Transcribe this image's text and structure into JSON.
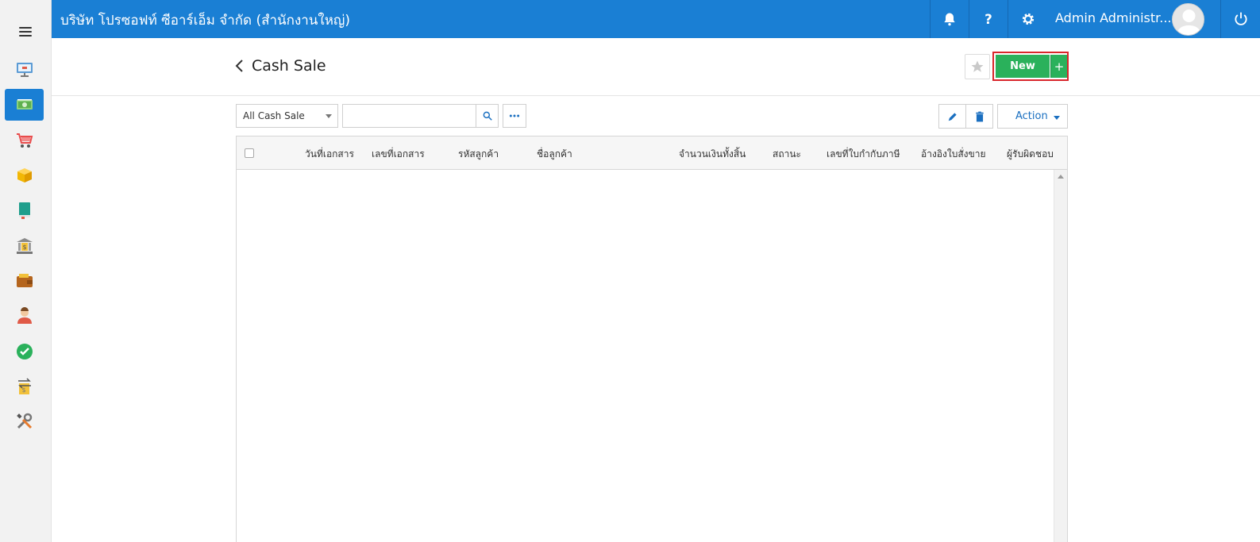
{
  "topbar": {
    "company": "บริษัท โปรซอฟท์ ซีอาร์เอ็ม จำกัด (สำนักงานใหญ่)",
    "user_name": "Admin Administr...",
    "bg_color": "#1a7fd4",
    "icons": [
      "bell-icon",
      "help-icon",
      "gear-icon",
      "power-icon"
    ]
  },
  "sidebar": {
    "items": [
      "dashboard-icon",
      "cash-icon",
      "cart-icon",
      "box-icon",
      "book-icon",
      "bank-icon",
      "wallet-icon",
      "user-icon",
      "check-icon",
      "transfer-icon",
      "tools-icon"
    ],
    "active_index": 1
  },
  "page": {
    "title": "Cash Sale",
    "new_label": "New",
    "plus_label": "+"
  },
  "toolbar": {
    "filter_value": "All Cash Sale",
    "search_value": "",
    "action_label": "Action"
  },
  "table": {
    "columns": [
      "วันที่เอกสาร",
      "เลขที่เอกสาร",
      "รหัสลูกค้า",
      "ชื่อลูกค้า",
      "จำนวนเงินทั้งสิ้น",
      "สถานะ",
      "เลขที่ใบกำกับภาษี",
      "อ้างอิงใบสั่งขาย",
      "ผู้รับผิดชอบ"
    ],
    "rows": []
  },
  "colors": {
    "accent": "#1a7fd4",
    "new_button": "#2ab15b",
    "highlight_border": "#d9262b"
  }
}
